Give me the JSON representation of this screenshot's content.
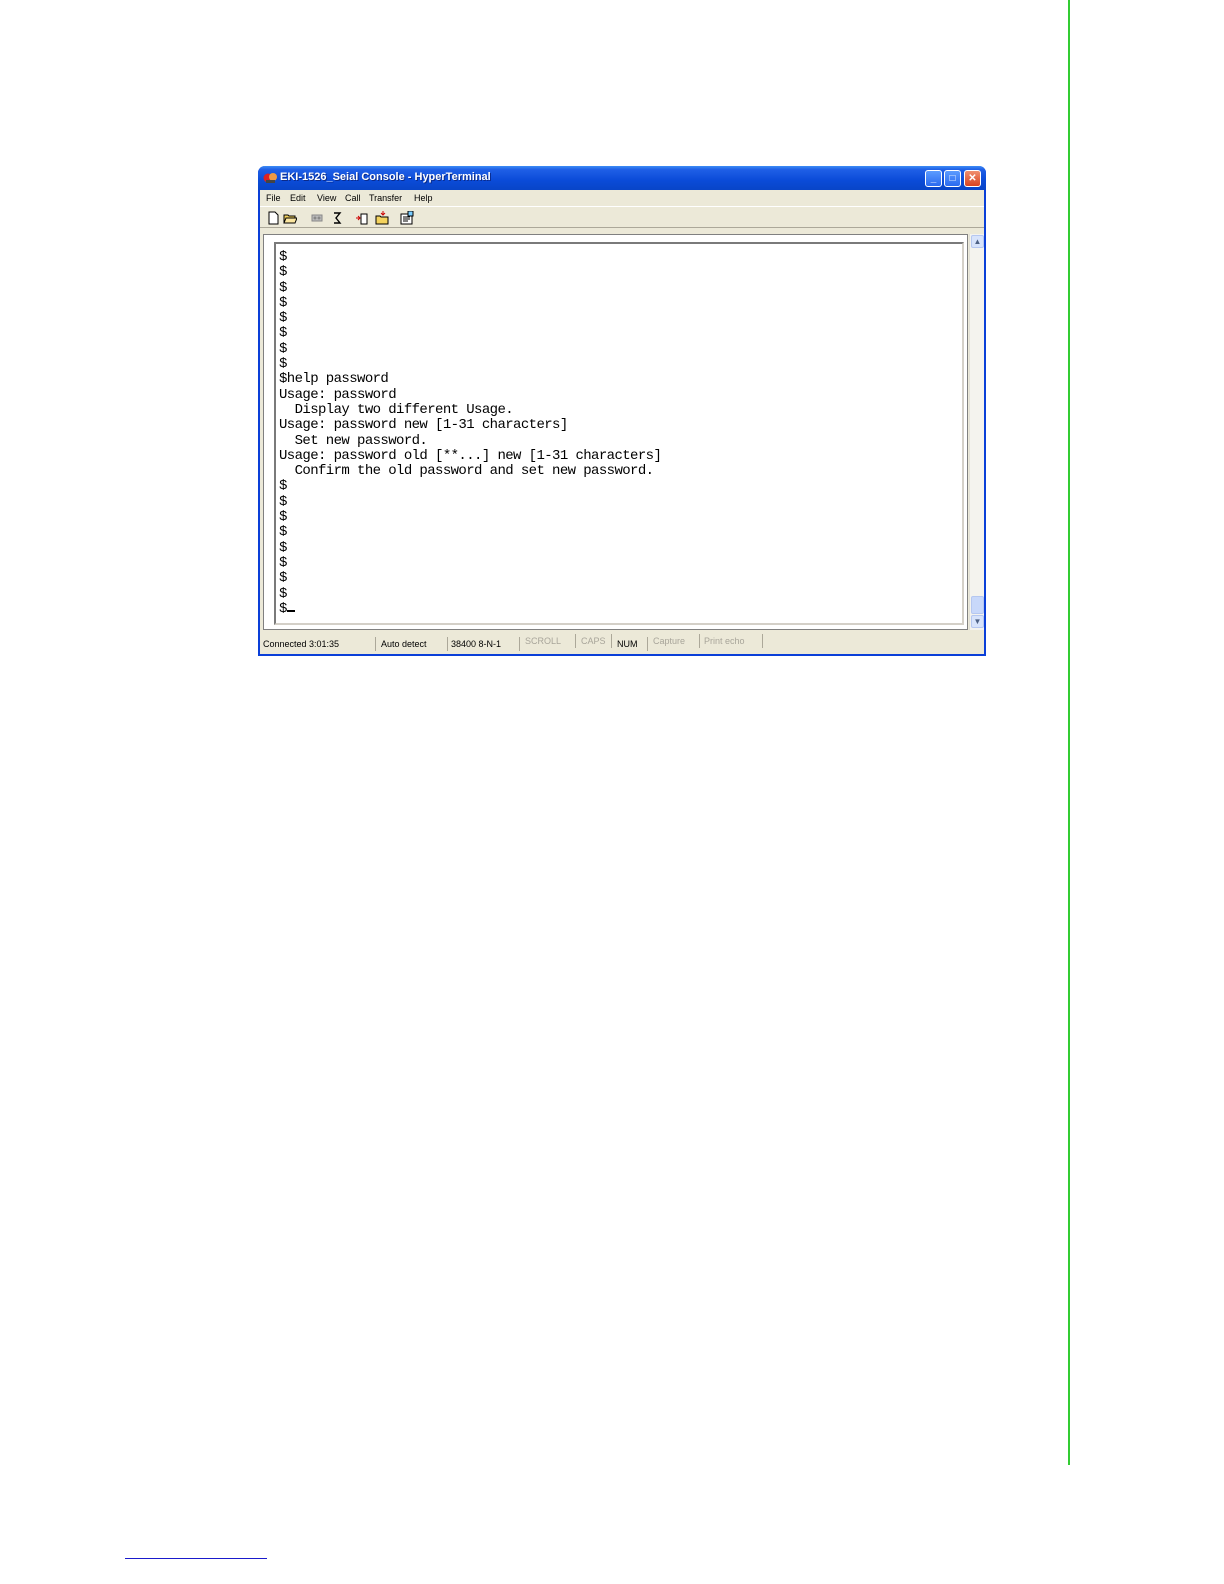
{
  "window": {
    "title": "EKI-1526_Seial Console - HyperTerminal",
    "controls": [
      "_",
      "□",
      "✕"
    ]
  },
  "menu": [
    "File",
    "Edit",
    "View",
    "Call",
    "Transfer",
    "Help"
  ],
  "toolbar_icons": [
    "new-icon",
    "open-icon",
    "disconnect-icon",
    "dial-icon",
    "send-icon",
    "receive-icon",
    "properties-icon"
  ],
  "terminal": {
    "lines": [
      "$",
      "$",
      "$",
      "$",
      "$",
      "$",
      "$",
      "$",
      "$help password",
      "Usage: password",
      "  Display two different Usage.",
      "Usage: password new [1-31 characters]",
      "  Set new password.",
      "Usage: password old [**...] new [1-31 characters]",
      "  Confirm the old password and set new password.",
      "$",
      "$",
      "$",
      "$",
      "$",
      "$",
      "$",
      "$",
      "$"
    ]
  },
  "statusbar": {
    "connected": "Connected 3:01:35",
    "detect": "Auto detect",
    "settings": "38400 8-N-1",
    "scroll": "SCROLL",
    "caps": "CAPS",
    "num": "NUM",
    "capture": "Capture",
    "print_echo": "Print echo"
  }
}
